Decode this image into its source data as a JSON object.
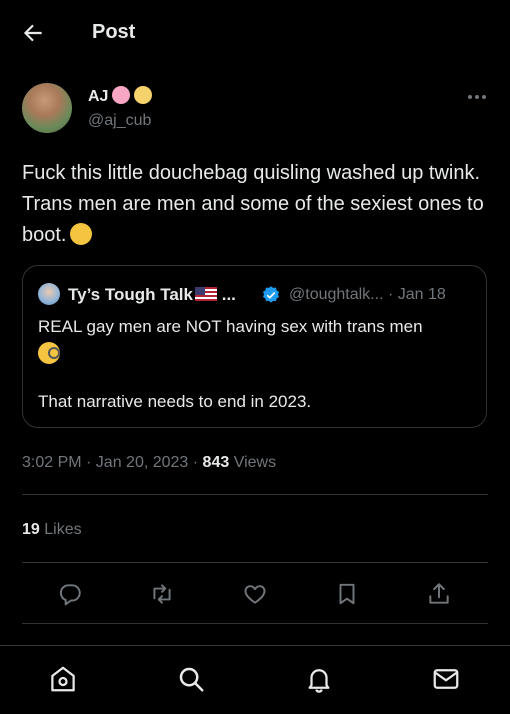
{
  "header": {
    "title": "Post",
    "back_icon": "arrow-left-icon"
  },
  "author": {
    "name": "AJ",
    "emojis": [
      "pig-face-emoji",
      "cowboy-hat-emoji"
    ],
    "handle": "@aj_cub"
  },
  "tweet": {
    "text": "Fuck this little douchebag quisling washed up twink. Trans men are men and some of the sexiest ones to boot.",
    "trailing_emoji": "yawning-face-emoji"
  },
  "quote": {
    "name": "Ty’s Tough Talk",
    "name_suffix": "...",
    "flag": "us-flag-emoji",
    "handle_date": "@toughtalk... · Jan 18",
    "line1": "REAL gay men are NOT having sex with trans men",
    "emoji": "monocle-face-emoji",
    "line2": "That narrative needs to end in 2023."
  },
  "meta": {
    "timestamp": "3:02 PM · Jan 20, 2023 · ",
    "views_count": "843",
    "views_label": " Views"
  },
  "stats": {
    "likes_count": "19",
    "likes_label": " Likes"
  },
  "actions": [
    "reply-icon",
    "repost-icon",
    "like-icon",
    "bookmark-icon",
    "share-icon"
  ],
  "bottom_nav": [
    "home-icon",
    "search-icon",
    "notifications-icon",
    "messages-icon"
  ],
  "colors": {
    "background": "#000000",
    "text": "#e7e9ea",
    "secondary": "#71767b",
    "border": "#2f3336",
    "verified": "#1d9bf0"
  }
}
